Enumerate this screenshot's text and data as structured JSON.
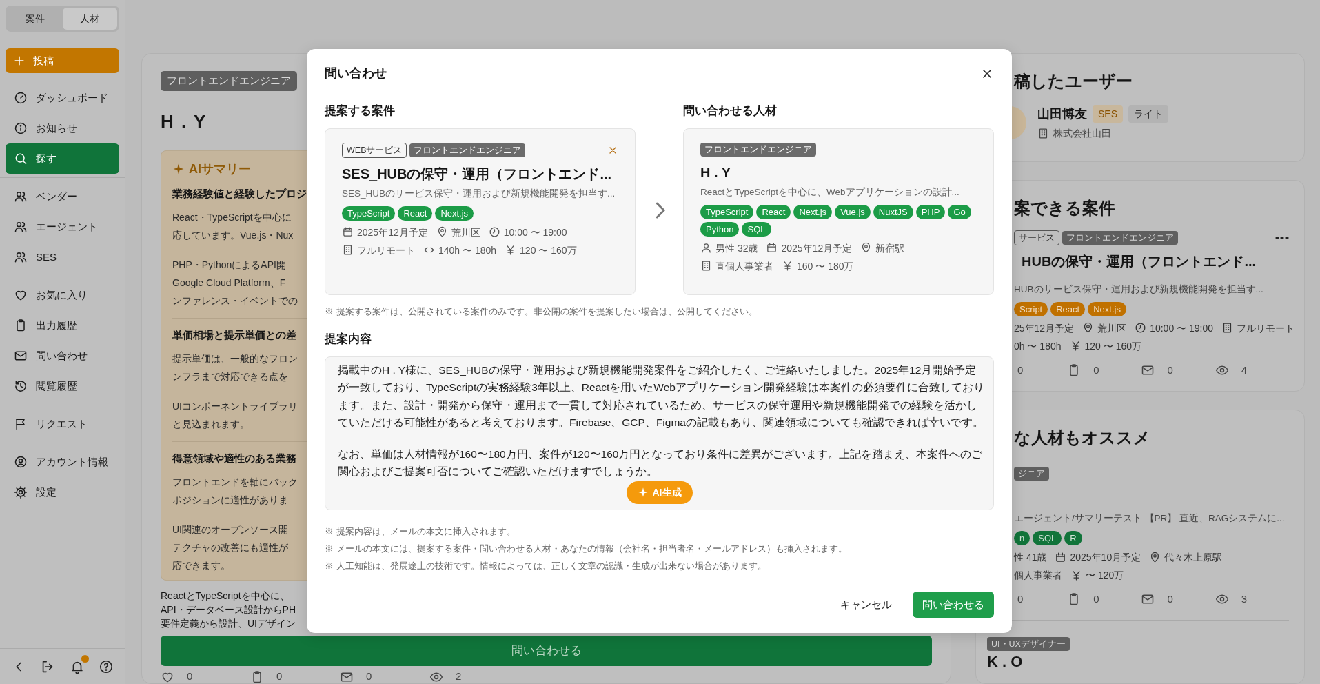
{
  "sidebar": {
    "switch": [
      {
        "label": "案件",
        "selected": false
      },
      {
        "label": "人材",
        "selected": true
      }
    ],
    "post_button": "投稿",
    "groups": [
      {
        "items": [
          {
            "label": "ダッシュボード",
            "selected": false
          },
          {
            "label": "お知らせ",
            "selected": false
          },
          {
            "label": "探す",
            "selected": true
          }
        ]
      },
      {
        "items": [
          {
            "label": "ベンダー",
            "selected": false
          },
          {
            "label": "エージェント",
            "selected": false
          },
          {
            "label": "SES",
            "selected": false
          }
        ]
      },
      {
        "items": [
          {
            "label": "お気に入り",
            "selected": false
          },
          {
            "label": "出力履歴",
            "selected": false
          },
          {
            "label": "問い合わせ",
            "selected": false
          },
          {
            "label": "閲覧履歴",
            "selected": false
          }
        ]
      },
      {
        "items": [
          {
            "label": "リクエスト",
            "selected": false
          }
        ]
      },
      {
        "items": [
          {
            "label": "アカウント情報",
            "selected": false
          },
          {
            "label": "設定",
            "selected": false
          }
        ]
      }
    ],
    "footer": {
      "has_unread": true
    }
  },
  "profile": {
    "role_tag": "フロントエンドエンジニア",
    "name": "H . Y",
    "ai_summary": {
      "title": "AIサマリー",
      "sections": [
        {
          "heading": "業務経験値と経験したプロジ",
          "paragraphs": [
            [
              "React・TypeScriptを中心に",
              "応しています。Vue.js・Nux"
            ],
            [
              "PHP・PythonによるAPI開",
              "Google Cloud Platform、F",
              "ンファレンス・イベントでの"
            ]
          ]
        },
        {
          "heading": "単価相場と提示単価との差",
          "paragraphs": [
            [
              "提示単価は、一般的なフロン",
              "ンフラまで対応できる点を"
            ],
            [
              "UIコンポーネントライブラリ",
              "と見込まれます。"
            ]
          ]
        },
        {
          "heading": "得意領域や適性のある業務",
          "paragraphs": [
            [
              "フロントエンドを軸にバック",
              "ポジションに適性がありま"
            ],
            [
              "UI関連のオープンソース開",
              "テクチャの改善にも適性が",
              "応できます。"
            ]
          ]
        }
      ]
    },
    "description_lines": [
      "ReactとTypeScriptを中心に、",
      "API・データベース設計からPH",
      "要件定義から設計、UIデザイン"
    ],
    "contact_button": "問い合わせる",
    "stats": [
      {
        "kind": "likes",
        "count": "0"
      },
      {
        "kind": "saves",
        "count": "0"
      },
      {
        "kind": "messages",
        "count": "0"
      },
      {
        "kind": "views",
        "count": "2"
      }
    ]
  },
  "poster_card": {
    "title": "稿したユーザー",
    "user": {
      "name": "山田博友",
      "badges": [
        {
          "label": "SES",
          "kind": "plan"
        },
        {
          "label": "ライト",
          "kind": "tier"
        }
      ],
      "company": "株式会社山田"
    }
  },
  "projects_card": {
    "title": "案できる案件",
    "items": [
      {
        "kind": "project",
        "tags": [
          {
            "label": "サービス",
            "kind": "category"
          },
          {
            "label": "フロントエンドエンジニア",
            "kind": "role"
          }
        ],
        "title": "_HUBの保守・運用（フロントエンド...",
        "description": "HUBのサービス保守・運用および新規機能開発を担当す...",
        "skills": [
          "Script",
          "React",
          "Next.js"
        ],
        "meta": [
          [
            {
              "text": "25年12月予定"
            },
            {
              "kind": "location",
              "text": "荒川区"
            },
            {
              "kind": "time",
              "text": "10:00 〜 19:00"
            },
            {
              "kind": "workstyle",
              "text": "フルリモート"
            }
          ],
          [
            {
              "text": "0h 〜 180h"
            },
            {
              "kind": "price",
              "text": "120 〜 160万"
            }
          ]
        ],
        "stats": [
          {
            "count": "0"
          },
          {
            "kind": "saves",
            "count": "0"
          },
          {
            "kind": "messages",
            "count": "0"
          },
          {
            "kind": "views",
            "count": "4"
          }
        ]
      }
    ]
  },
  "recommend_card": {
    "title": "な人材もオススメ",
    "items": [
      {
        "kind": "talent",
        "tags": [
          {
            "label": "ジニア",
            "kind": "role"
          }
        ],
        "description": "エージェント/サマリーテスト 【PR】 直近、RAGシステムに...",
        "skills": [
          "n",
          "SQL",
          "R"
        ],
        "meta": [
          [
            {
              "text": "性 41歳"
            },
            {
              "kind": "date",
              "text": "2025年10月予定"
            },
            {
              "kind": "location",
              "text": "代々木上原駅"
            }
          ],
          [
            {
              "text": "個人事業者"
            },
            {
              "kind": "price",
              "text": "〜 120万"
            }
          ]
        ],
        "stats": [
          {
            "count": "0"
          },
          {
            "kind": "saves",
            "count": "0"
          },
          {
            "kind": "messages",
            "count": "0"
          },
          {
            "kind": "views",
            "count": "3"
          }
        ]
      },
      {
        "kind": "talent",
        "tags": [
          {
            "label": "UI・UXデザイナー",
            "kind": "role"
          }
        ],
        "name": "K . O"
      }
    ]
  },
  "modal": {
    "title": "問い合わせ",
    "project_section": {
      "heading": "提案する案件",
      "card": {
        "kind": "project",
        "removable": true,
        "tags": [
          {
            "label": "WEBサービス",
            "kind": "category"
          },
          {
            "label": "フロントエンドエンジニア",
            "kind": "role"
          }
        ],
        "title": "SES_HUBの保守・運用（フロントエンド...",
        "description": "SES_HUBのサービス保守・運用および新規機能開発を担当す...",
        "skills": [
          "TypeScript",
          "React",
          "Next.js"
        ],
        "meta": [
          [
            {
              "kind": "date",
              "text": "2025年12月予定"
            },
            {
              "kind": "location",
              "text": "荒川区"
            },
            {
              "kind": "time",
              "text": "10:00 〜 19:00"
            }
          ],
          [
            {
              "kind": "workstyle",
              "text": "フルリモート"
            },
            {
              "kind": "hours",
              "text": "140h 〜 180h"
            },
            {
              "kind": "price",
              "text": "120 〜 160万"
            }
          ]
        ]
      }
    },
    "talent_section": {
      "heading": "問い合わせる人材",
      "card": {
        "kind": "talent",
        "tags": [
          {
            "label": "フロントエンドエンジニア",
            "kind": "role"
          }
        ],
        "name": "H . Y",
        "description": "ReactとTypeScriptを中心に、Webアプリケーションの設計...",
        "skills": [
          "TypeScript",
          "React",
          "Next.js",
          "Vue.js",
          "NuxtJS",
          "PHP",
          "Go",
          "Python",
          "SQL"
        ],
        "meta": [
          [
            {
              "kind": "profile",
              "text": "男性 32歳"
            },
            {
              "kind": "date",
              "text": "2025年12月予定"
            },
            {
              "kind": "location",
              "text": "新宿駅"
            }
          ],
          [
            {
              "kind": "contract",
              "text": "直個人事業者"
            },
            {
              "kind": "price",
              "text": "160 〜 180万"
            }
          ]
        ]
      }
    },
    "notice": "※ 提案する案件は、公開されている案件のみです。非公開の案件を提案したい場合は、公開してください。",
    "proposal": {
      "heading": "提案内容",
      "paragraphs": [
        "掲載中のH . Y様に、SES_HUBの保守・運用および新規機能開発案件をご紹介したく、ご連絡いたしました。2025年12月開始予定が一致しており、TypeScriptの実務経験3年以上、Reactを用いたWebアプリケーション開発経験は本案件の必須要件に合致しております。また、設計・開発から保守・運用まで一貫して対応されているため、サービスの保守運用や新規機能開発での経験を活かしていただける可能性があると考えております。Firebase、GCP、Figmaの記載もあり、関連領域についても確認できれば幸いです。",
        "なお、単価は人材情報が160〜180万円、案件が120〜160万円となっており条件に差異がございます。上記を踏まえ、本案件へのご関心およびご提案可否についてご確認いただけますでしょうか。"
      ],
      "ai_button": "AI生成"
    },
    "notes": [
      "※ 提案内容は、メールの本文に挿入されます。",
      "※ メールの本文には、提案する案件・問い合わせる人材・あなたの情報（会社名・担当者名・メールアドレス）も挿入されます。",
      "※ 人工知能は、発展途上の技術です。情報によっては、正しく文章の認識・生成が出来ない場合があります。"
    ],
    "cancel": "キャンセル",
    "submit": "問い合わせる"
  }
}
